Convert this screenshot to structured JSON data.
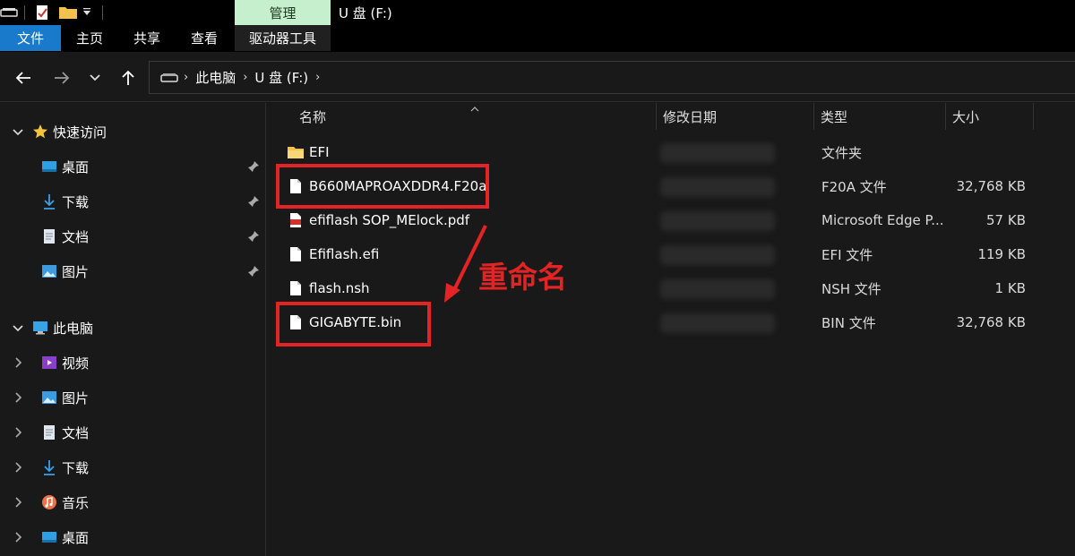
{
  "window": {
    "title": "U 盘 (F:)",
    "context_tab": "管理"
  },
  "ribbon": {
    "tabs": [
      "文件",
      "主页",
      "共享",
      "查看",
      "驱动器工具"
    ]
  },
  "address_bar": {
    "crumbs": [
      "此电脑",
      "U 盘 (F:)"
    ]
  },
  "sidebar": {
    "quick_access": {
      "label": "快速访问",
      "items": [
        "桌面",
        "下载",
        "文档",
        "图片"
      ]
    },
    "this_pc": {
      "label": "此电脑",
      "items": [
        "视频",
        "图片",
        "文档",
        "下载",
        "音乐",
        "桌面"
      ]
    }
  },
  "columns": {
    "name": "名称",
    "modified": "修改日期",
    "type": "类型",
    "size": "大小"
  },
  "files": [
    {
      "name": "EFI",
      "type": "文件夹",
      "size": "",
      "icon": "folder-icon"
    },
    {
      "name": "B660MAPROAXDDR4.F20a",
      "type": "F20A 文件",
      "size": "32,768 KB",
      "icon": "file-icon"
    },
    {
      "name": "efiflash SOP_MElock.pdf",
      "type": "Microsoft Edge P...",
      "size": "57 KB",
      "icon": "pdf-icon"
    },
    {
      "name": "Efiflash.efi",
      "type": "EFI 文件",
      "size": "119 KB",
      "icon": "file-icon"
    },
    {
      "name": "flash.nsh",
      "type": "NSH 文件",
      "size": "1 KB",
      "icon": "file-icon"
    },
    {
      "name": "GIGABYTE.bin",
      "type": "BIN 文件",
      "size": "32,768 KB",
      "icon": "file-icon"
    }
  ],
  "annotation": {
    "text": "重命名",
    "color": "#e42424"
  },
  "colors": {
    "background": "#191919",
    "accent": "#1979ca",
    "manage_tab": "#c6efce"
  }
}
